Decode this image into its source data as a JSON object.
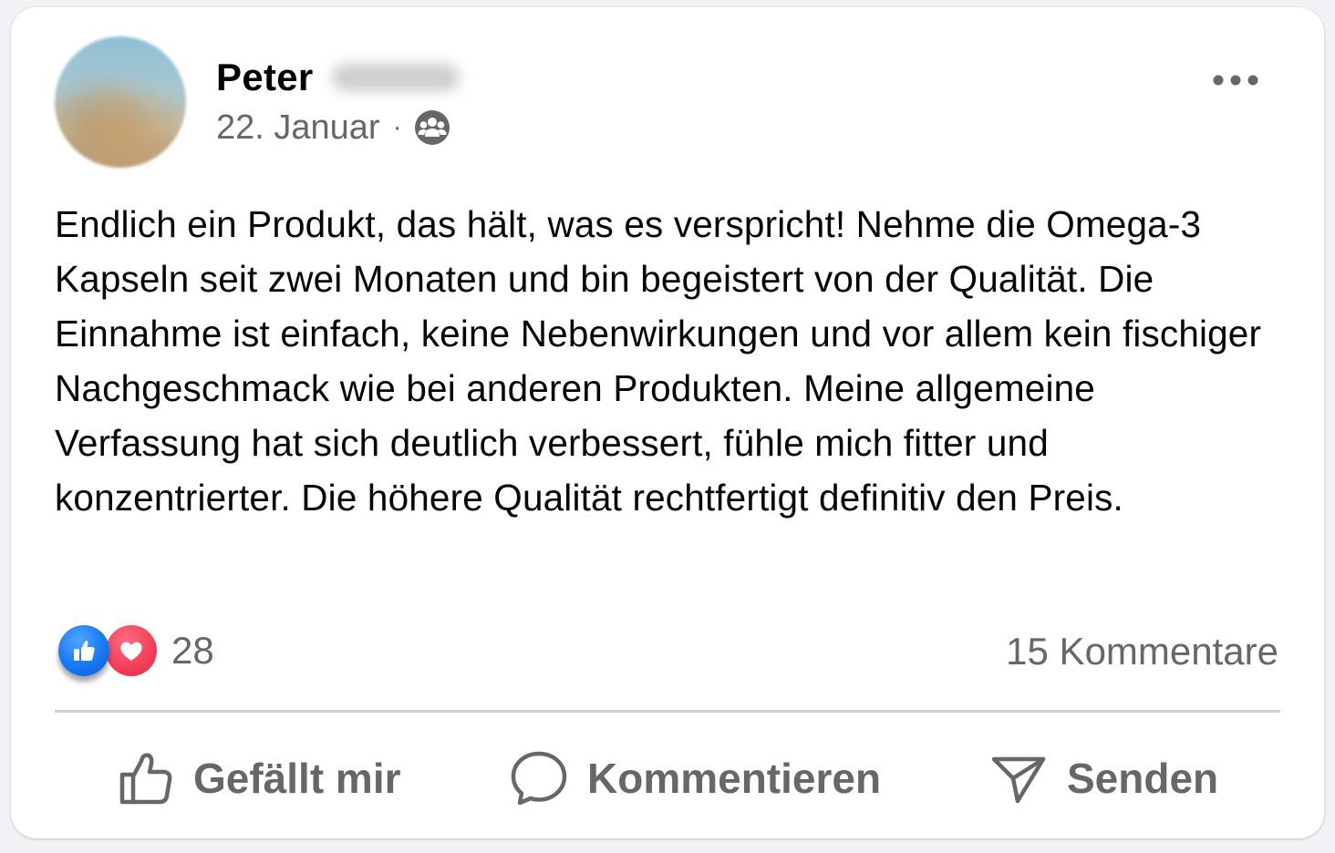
{
  "post": {
    "author_first_name": "Peter",
    "date": "22. Januar",
    "separator": "·",
    "audience_icon": "friends-audience-icon",
    "more_icon": "more-options-icon",
    "text": "Endlich ein Produkt, das hält, was es verspricht! Nehme die Omega-3 Kapseln seit zwei Monaten und bin begeistert von der Qualität. Die Einnahme ist einfach, keine Nebenwirkungen und vor allem kein fischiger Nachgeschmack wie bei anderen Produkten. Meine allgemeine Verfassung hat sich deutlich verbessert, fühle mich fitter und konzentrierter. Die höhere Qualität rechtfertigt definitiv den Preis."
  },
  "reactions": {
    "icons": [
      "like-reaction-icon",
      "love-reaction-icon"
    ],
    "count": "28"
  },
  "comments": {
    "count_label": "15 Kommentare"
  },
  "actions": {
    "like_label": "Gefällt mir",
    "comment_label": "Kommentieren",
    "send_label": "Senden"
  },
  "colors": {
    "card_background": "#ffffff",
    "primary_text": "#050505",
    "secondary_text": "#65676b",
    "like_blue": "#1877f2",
    "love_red": "#f33e58",
    "divider": "#ced0d4"
  }
}
